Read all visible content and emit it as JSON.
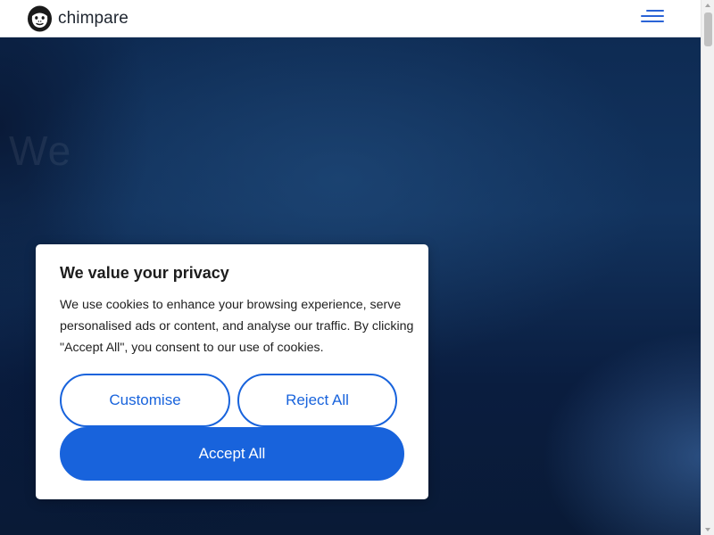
{
  "header": {
    "logo_text": "chimpare",
    "logo_icon": "chimp-face-logo",
    "menu_icon": "hamburger-menu-icon"
  },
  "hero": {
    "faded_text": "We"
  },
  "cookie_banner": {
    "title": "We value your privacy",
    "body": "We use cookies to enhance your browsing experience, serve personalised ads or content, and analyse our traffic. By clicking \"Accept All\", you consent to our use of cookies.",
    "customise_label": "Customise",
    "reject_label": "Reject All",
    "accept_label": "Accept All"
  },
  "colors": {
    "accent": "#1863dc",
    "menu_icon": "#2a63d6",
    "hero_dark": "#0a1d3f",
    "banner_bg": "#ffffff"
  }
}
